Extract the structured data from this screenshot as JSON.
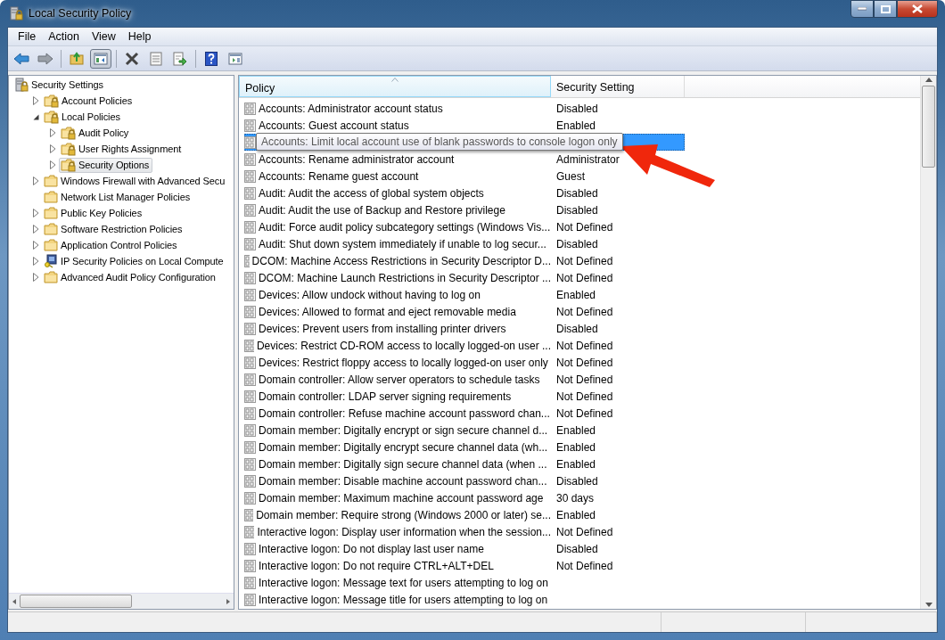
{
  "window": {
    "title": "Local Security Policy"
  },
  "menu": [
    "File",
    "Action",
    "View",
    "Help"
  ],
  "toolbar": [
    {
      "kind": "back",
      "pressed": false
    },
    {
      "kind": "forward",
      "pressed": false
    },
    {
      "kind": "sep"
    },
    {
      "kind": "up",
      "pressed": false
    },
    {
      "kind": "tree",
      "pressed": true
    },
    {
      "kind": "sep"
    },
    {
      "kind": "delete",
      "pressed": false
    },
    {
      "kind": "properties",
      "pressed": false
    },
    {
      "kind": "export",
      "pressed": false
    },
    {
      "kind": "sep"
    },
    {
      "kind": "help",
      "pressed": false
    },
    {
      "kind": "pane",
      "pressed": false
    }
  ],
  "tree": [
    {
      "label": "Security Settings",
      "kind": "root",
      "selected": false,
      "children": [
        {
          "label": "Account Policies",
          "kind": "secure",
          "expandable": true,
          "expanded": false,
          "selected": false
        },
        {
          "label": "Local Policies",
          "kind": "secure",
          "expandable": true,
          "expanded": true,
          "selected": false,
          "children": [
            {
              "label": "Audit Policy",
              "kind": "secure",
              "expandable": true,
              "expanded": false,
              "selected": false
            },
            {
              "label": "User Rights Assignment",
              "kind": "secure",
              "expandable": true,
              "expanded": false,
              "selected": false
            },
            {
              "label": "Security Options",
              "kind": "secure",
              "expandable": true,
              "expanded": false,
              "selected": true
            }
          ]
        },
        {
          "label": "Windows Firewall with Advanced Secu",
          "kind": "folder",
          "expandable": true,
          "expanded": false,
          "selected": false
        },
        {
          "label": "Network List Manager Policies",
          "kind": "folder",
          "expandable": false,
          "selected": false
        },
        {
          "label": "Public Key Policies",
          "kind": "folder",
          "expandable": true,
          "expanded": false,
          "selected": false
        },
        {
          "label": "Software Restriction Policies",
          "kind": "folder",
          "expandable": true,
          "expanded": false,
          "selected": false
        },
        {
          "label": "Application Control Policies",
          "kind": "folder",
          "expandable": true,
          "expanded": false,
          "selected": false
        },
        {
          "label": "IP Security Policies on Local Compute",
          "kind": "ip",
          "expandable": true,
          "expanded": false,
          "selected": false
        },
        {
          "label": "Advanced Audit Policy Configuration",
          "kind": "folder",
          "expandable": true,
          "expanded": false,
          "selected": false
        }
      ]
    }
  ],
  "table": {
    "columns": [
      "Policy",
      "Security Setting"
    ],
    "rows": [
      {
        "policy": "Accounts: Administrator account status",
        "setting": "Disabled",
        "selected": false
      },
      {
        "policy": "Accounts: Guest account status",
        "setting": "Enabled",
        "selected": false
      },
      {
        "selected": true,
        "tooltip": "Accounts: Limit local account use of blank passwords to console logon only"
      },
      {
        "policy": "Accounts: Rename administrator account",
        "setting": "Administrator",
        "selected": false
      },
      {
        "policy": "Accounts: Rename guest account",
        "setting": "Guest",
        "selected": false
      },
      {
        "policy": "Audit: Audit the access of global system objects",
        "setting": "Disabled",
        "selected": false
      },
      {
        "policy": "Audit: Audit the use of Backup and Restore privilege",
        "setting": "Disabled",
        "selected": false
      },
      {
        "policy": "Audit: Force audit policy subcategory settings (Windows Vis...",
        "setting": "Not Defined",
        "selected": false
      },
      {
        "policy": "Audit: Shut down system immediately if unable to log secur...",
        "setting": "Disabled",
        "selected": false
      },
      {
        "policy": "DCOM: Machine Access Restrictions in Security Descriptor D...",
        "setting": "Not Defined",
        "selected": false
      },
      {
        "policy": "DCOM: Machine Launch Restrictions in Security Descriptor ...",
        "setting": "Not Defined",
        "selected": false
      },
      {
        "policy": "Devices: Allow undock without having to log on",
        "setting": "Enabled",
        "selected": false
      },
      {
        "policy": "Devices: Allowed to format and eject removable media",
        "setting": "Not Defined",
        "selected": false
      },
      {
        "policy": "Devices: Prevent users from installing printer drivers",
        "setting": "Disabled",
        "selected": false
      },
      {
        "policy": "Devices: Restrict CD-ROM access to locally logged-on user ...",
        "setting": "Not Defined",
        "selected": false
      },
      {
        "policy": "Devices: Restrict floppy access to locally logged-on user only",
        "setting": "Not Defined",
        "selected": false
      },
      {
        "policy": "Domain controller: Allow server operators to schedule tasks",
        "setting": "Not Defined",
        "selected": false
      },
      {
        "policy": "Domain controller: LDAP server signing requirements",
        "setting": "Not Defined",
        "selected": false
      },
      {
        "policy": "Domain controller: Refuse machine account password chan...",
        "setting": "Not Defined",
        "selected": false
      },
      {
        "policy": "Domain member: Digitally encrypt or sign secure channel d...",
        "setting": "Enabled",
        "selected": false
      },
      {
        "policy": "Domain member: Digitally encrypt secure channel data (wh...",
        "setting": "Enabled",
        "selected": false
      },
      {
        "policy": "Domain member: Digitally sign secure channel data (when ...",
        "setting": "Enabled",
        "selected": false
      },
      {
        "policy": "Domain member: Disable machine account password chan...",
        "setting": "Disabled",
        "selected": false
      },
      {
        "policy": "Domain member: Maximum machine account password age",
        "setting": "30 days",
        "selected": false
      },
      {
        "policy": "Domain member: Require strong (Windows 2000 or later) se...",
        "setting": "Enabled",
        "selected": false
      },
      {
        "policy": "Interactive logon: Display user information when the session...",
        "setting": "Not Defined",
        "selected": false
      },
      {
        "policy": "Interactive logon: Do not display last user name",
        "setting": "Disabled",
        "selected": false
      },
      {
        "policy": "Interactive logon: Do not require CTRL+ALT+DEL",
        "setting": "Not Defined",
        "selected": false
      },
      {
        "policy": "Interactive logon: Message text for users attempting to log on",
        "selected": false
      },
      {
        "policy": "Interactive logon: Message title for users attempting to log on",
        "selected": false
      }
    ]
  }
}
